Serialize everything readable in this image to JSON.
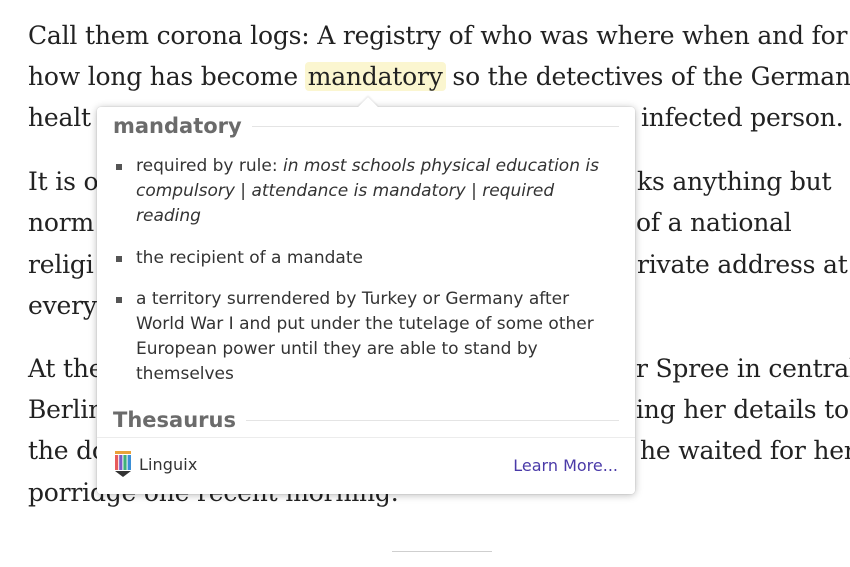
{
  "article": {
    "line1": "Call them corona logs: A registry of who was where when and for",
    "line2_pre": "how long has become ",
    "line2_highlight": "mandatory",
    "line2_post": " so the detectives of the German",
    "line3_left": "healt",
    "line3_right": "infected person.",
    "line4_left": "It is o",
    "line4_right": "ks anything but",
    "line5_left": "norm",
    "line5_right": "of a national",
    "line6_left": "religi",
    "line6_right": "rivate address at",
    "line7_left": "every",
    "line8_left": "At the",
    "line8_right": "r Spree in central",
    "line9_left": "Berlin",
    "line9_right": "ing her details to",
    "line10_left": "the do",
    "line10_right": "he waited for her",
    "line11": "porridge one recent morning."
  },
  "popup": {
    "word": "mandatory",
    "definitions": [
      {
        "gloss": "required by rule: ",
        "examples": "in most schools physical education is compulsory | attendance is mandatory | required reading"
      },
      {
        "gloss": "the recipient of a mandate",
        "examples": ""
      },
      {
        "gloss": "a territory surrendered by Turkey or Germany after World War I and put under the tutelage of some other European power until they are able to stand by themselves",
        "examples": ""
      }
    ],
    "thesaurus_title": "Thesaurus",
    "brand_name": "Linguix",
    "learn_more": "Learn More...",
    "brand_icon": "linguix-logo-icon",
    "link_color": "#4a3aa8",
    "highlight_color": "#fbf6d0"
  }
}
